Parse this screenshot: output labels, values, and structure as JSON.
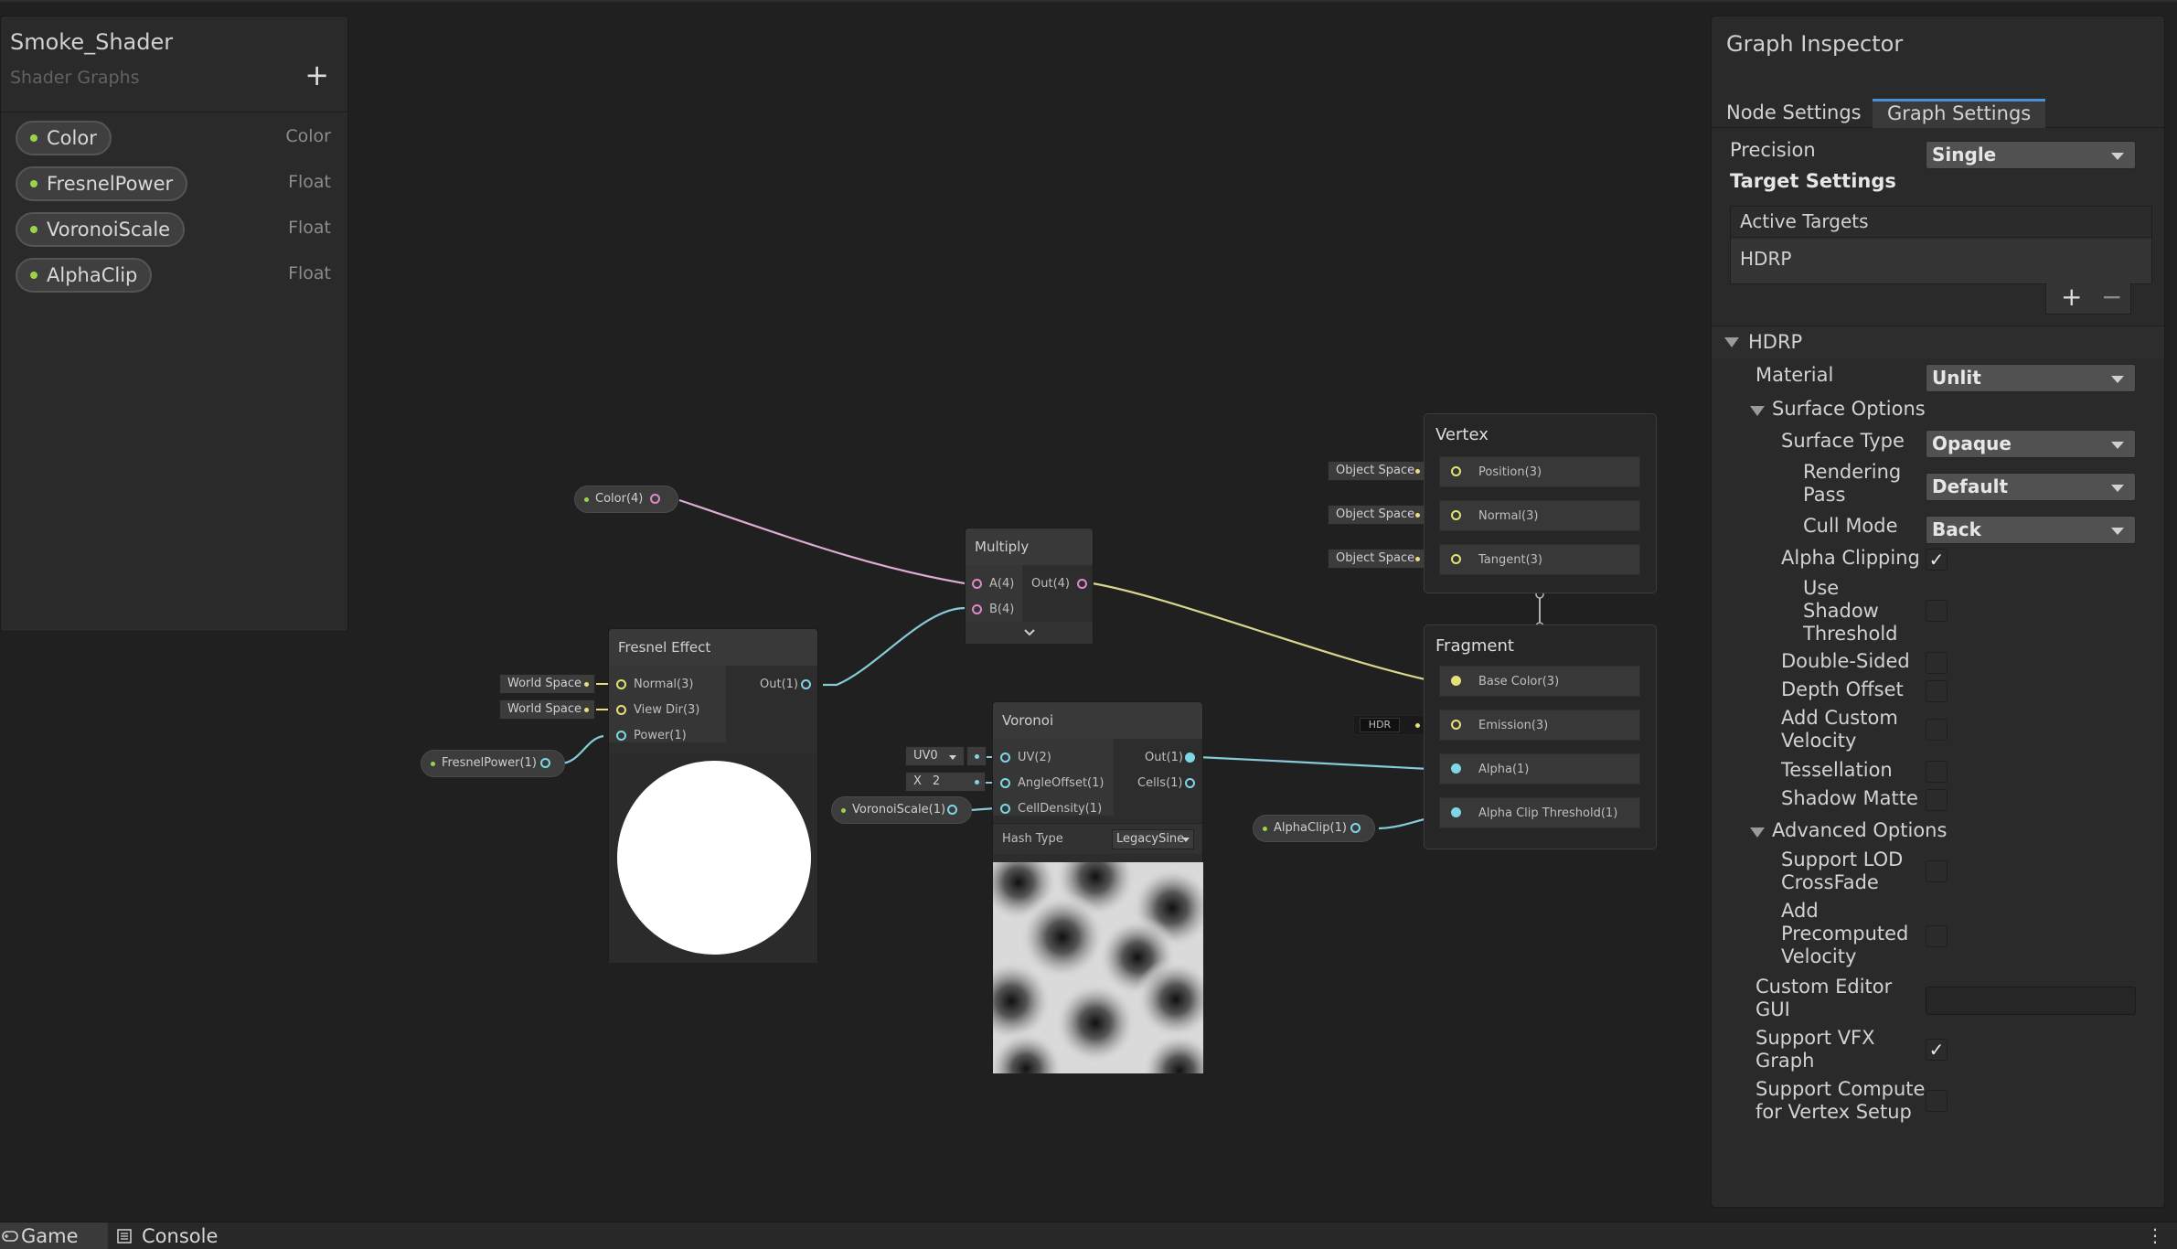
{
  "blackboard": {
    "title": "Smoke_Shader",
    "subtitle": "Shader Graphs",
    "add_icon": "+",
    "properties": [
      {
        "name": "Color",
        "type": "Color"
      },
      {
        "name": "FresnelPower",
        "type": "Float"
      },
      {
        "name": "VoronoiScale",
        "type": "Float"
      },
      {
        "name": "AlphaClip",
        "type": "Float"
      }
    ]
  },
  "graph": {
    "color_prop": "Color(4)",
    "fresnel_prop": "FresnelPower(1)",
    "voronoi_prop": "VoronoiScale(1)",
    "alphaclip_prop": "AlphaClip(1)",
    "multiply": {
      "title": "Multiply",
      "in_a": "A(4)",
      "in_b": "B(4)",
      "out": "Out(4)",
      "expand_icon": "chevron-down"
    },
    "fresnel": {
      "title": "Fresnel Effect",
      "in_normal": "Normal(3)",
      "in_view": "View Dir(3)",
      "in_power": "Power(1)",
      "out": "Out(1)",
      "tag_normal": "World Space",
      "tag_view": "World Space"
    },
    "voronoi": {
      "title": "Voronoi",
      "in_uv": "UV(2)",
      "in_angle": "AngleOffset(1)",
      "in_cell": "CellDensity(1)",
      "out": "Out(1)",
      "cells": "Cells(1)",
      "uv_tag": "UV0",
      "x_label": "X",
      "x_value": "2",
      "hash_label": "Hash Type",
      "hash_value": "LegacySine"
    },
    "vertex": {
      "title": "Vertex",
      "slots": [
        "Position(3)",
        "Normal(3)",
        "Tangent(3)"
      ],
      "tags": [
        "Object Space",
        "Object Space",
        "Object Space"
      ]
    },
    "fragment": {
      "title": "Fragment",
      "slots": [
        "Base Color(3)",
        "Emission(3)",
        "Alpha(1)",
        "Alpha Clip Threshold(1)"
      ],
      "hdr_tag": "HDR"
    }
  },
  "inspector": {
    "title": "Graph Inspector",
    "tabs": [
      "Node Settings",
      "Graph Settings"
    ],
    "active_tab": "Graph Settings",
    "precision_label": "Precision",
    "precision_value": "Single",
    "target_settings": "Target Settings",
    "active_targets": "Active Targets",
    "target_item": "HDRP",
    "add_icon": "+",
    "remove_icon": "−",
    "hdrp_section": "HDRP",
    "material_label": "Material",
    "material_value": "Unlit",
    "surface_options": "Surface Options",
    "surface_type_label": "Surface Type",
    "surface_type_value": "Opaque",
    "rendering_pass_label": "Rendering Pass",
    "rendering_pass_value": "Default",
    "cull_mode_label": "Cull Mode",
    "cull_mode_value": "Back",
    "alpha_clipping_label": "Alpha Clipping",
    "alpha_clipping": true,
    "use_shadow_threshold_label": "Use Shadow Threshold",
    "use_shadow_threshold": false,
    "double_sided_label": "Double-Sided",
    "double_sided": false,
    "depth_offset_label": "Depth Offset",
    "depth_offset": false,
    "add_custom_velocity_label": "Add Custom Velocity",
    "add_custom_velocity": false,
    "tessellation_label": "Tessellation",
    "tessellation": false,
    "shadow_matte_label": "Shadow Matte",
    "shadow_matte": false,
    "advanced_options": "Advanced Options",
    "support_lod_label": "Support LOD CrossFade",
    "support_lod": false,
    "add_precomputed_label": "Add Precomputed Velocity",
    "add_precomputed": false,
    "custom_editor_label": "Custom Editor GUI",
    "custom_editor_value": "",
    "support_vfx_label": "Support VFX Graph",
    "support_vfx": true,
    "support_compute_label": "Support Compute for Vertex Setup",
    "support_compute": false
  },
  "bottom_tabs": [
    {
      "label": "Game",
      "icon": "gamepad-icon"
    },
    {
      "label": "Console",
      "icon": "console-icon"
    }
  ],
  "colors": {
    "vector4_port": "#e089c8",
    "float_port": "#7fd6e6",
    "vector3_port": "#e5e07a",
    "property_dot": "#9bd44a",
    "tab_accent": "#4a90d8"
  }
}
